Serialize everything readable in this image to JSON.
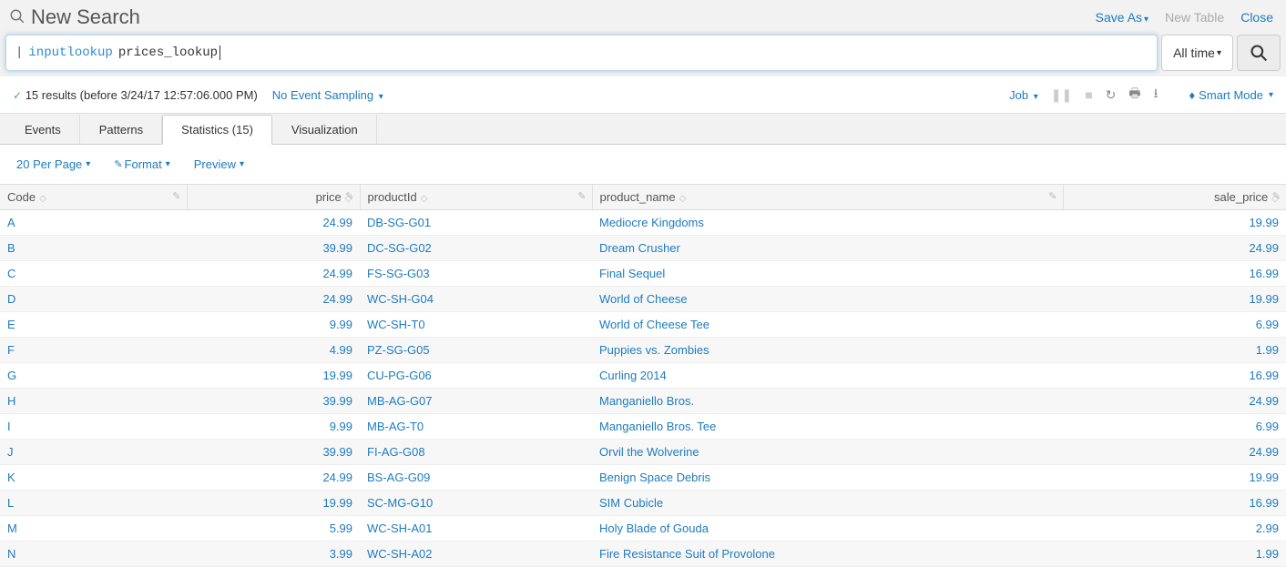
{
  "header": {
    "title": "New Search",
    "save_as": "Save As",
    "new_table": "New Table",
    "close": "Close"
  },
  "search": {
    "pipe": "|",
    "command": "inputlookup",
    "argument": "prices_lookup",
    "time_label": "All time"
  },
  "status": {
    "result_text": "15 results (before 3/24/17 12:57:06.000 PM)",
    "sampling": "No Event Sampling",
    "job": "Job",
    "smart_mode": "Smart Mode"
  },
  "tabs": {
    "events": "Events",
    "patterns": "Patterns",
    "statistics": "Statistics (15)",
    "visualization": "Visualization"
  },
  "options": {
    "per_page": "20 Per Page",
    "format": "Format",
    "preview": "Preview"
  },
  "columns": {
    "code": "Code",
    "price": "price",
    "productId": "productId",
    "product_name": "product_name",
    "sale_price": "sale_price"
  },
  "rows": [
    {
      "code": "A",
      "price": "24.99",
      "productId": "DB-SG-G01",
      "product_name": "Mediocre Kingdoms",
      "sale_price": "19.99"
    },
    {
      "code": "B",
      "price": "39.99",
      "productId": "DC-SG-G02",
      "product_name": "Dream Crusher",
      "sale_price": "24.99"
    },
    {
      "code": "C",
      "price": "24.99",
      "productId": "FS-SG-G03",
      "product_name": "Final Sequel",
      "sale_price": "16.99"
    },
    {
      "code": "D",
      "price": "24.99",
      "productId": "WC-SH-G04",
      "product_name": "World of Cheese",
      "sale_price": "19.99"
    },
    {
      "code": "E",
      "price": "9.99",
      "productId": "WC-SH-T0",
      "product_name": "World of Cheese Tee",
      "sale_price": "6.99"
    },
    {
      "code": "F",
      "price": "4.99",
      "productId": "PZ-SG-G05",
      "product_name": "Puppies vs. Zombies",
      "sale_price": "1.99"
    },
    {
      "code": "G",
      "price": "19.99",
      "productId": "CU-PG-G06",
      "product_name": "Curling 2014",
      "sale_price": "16.99"
    },
    {
      "code": "H",
      "price": "39.99",
      "productId": "MB-AG-G07",
      "product_name": "Manganiello Bros.",
      "sale_price": "24.99"
    },
    {
      "code": "I",
      "price": "9.99",
      "productId": "MB-AG-T0",
      "product_name": "Manganiello Bros. Tee",
      "sale_price": "6.99"
    },
    {
      "code": "J",
      "price": "39.99",
      "productId": "FI-AG-G08",
      "product_name": "Orvil the Wolverine",
      "sale_price": "24.99"
    },
    {
      "code": "K",
      "price": "24.99",
      "productId": "BS-AG-G09",
      "product_name": "Benign Space Debris",
      "sale_price": "19.99"
    },
    {
      "code": "L",
      "price": "19.99",
      "productId": "SC-MG-G10",
      "product_name": "SIM Cubicle",
      "sale_price": "16.99"
    },
    {
      "code": "M",
      "price": "5.99",
      "productId": "WC-SH-A01",
      "product_name": "Holy Blade of Gouda",
      "sale_price": "2.99"
    },
    {
      "code": "N",
      "price": "3.99",
      "productId": "WC-SH-A02",
      "product_name": "Fire Resistance Suit of Provolone",
      "sale_price": "1.99"
    }
  ]
}
